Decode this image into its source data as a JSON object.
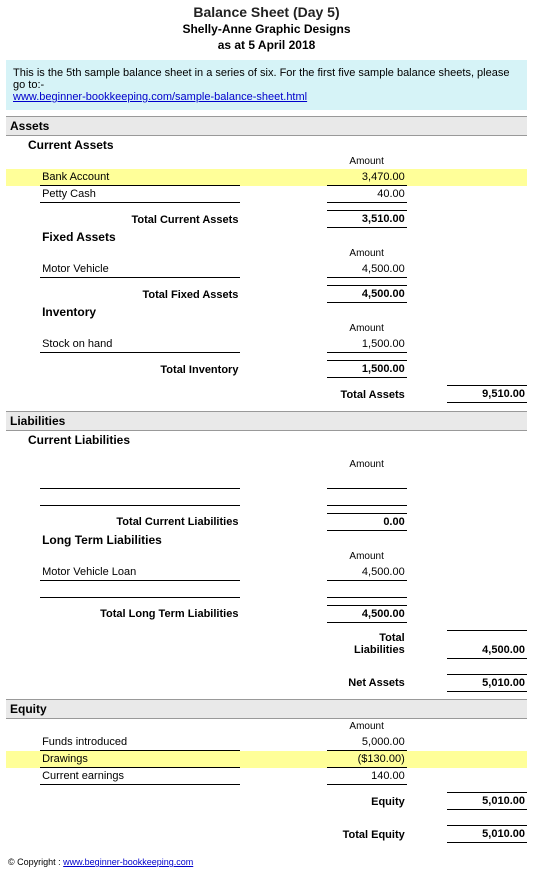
{
  "header": {
    "title": "Balance Sheet (Day 5)",
    "subtitle": "Shelly-Anne Graphic Designs",
    "date": "as at 5 April 2018"
  },
  "note": {
    "text": "This is the 5th sample balance sheet in a series of six. For the first five sample balance sheets, please go to:-",
    "link": "www.beginner-bookkeeping.com/sample-balance-sheet.html"
  },
  "col_amount": "Amount",
  "assets": {
    "heading": "Assets",
    "current": {
      "heading": "Current Assets",
      "items": [
        {
          "label": "Bank Account",
          "value": "3,470.00"
        },
        {
          "label": "Petty Cash",
          "value": "40.00"
        }
      ],
      "total_label": "Total Current Assets",
      "total_value": "3,510.00"
    },
    "fixed": {
      "heading": "Fixed Assets",
      "items": [
        {
          "label": "Motor Vehicle",
          "value": "4,500.00"
        }
      ],
      "total_label": "Total Fixed Assets",
      "total_value": "4,500.00"
    },
    "inventory": {
      "heading": "Inventory",
      "items": [
        {
          "label": "Stock on hand",
          "value": "1,500.00"
        }
      ],
      "total_label": "Total Inventory",
      "total_value": "1,500.00"
    },
    "grand_label": "Total Assets",
    "grand_value": "9,510.00"
  },
  "liabilities": {
    "heading": "Liabilities",
    "current": {
      "heading": "Current Liabilities",
      "total_label": "Total Current Liabilities",
      "total_value": "0.00"
    },
    "longterm": {
      "heading": "Long Term Liabilities",
      "items": [
        {
          "label": "Motor Vehicle Loan",
          "value": "4,500.00"
        }
      ],
      "total_label": "Total Long Term Liabilities",
      "total_value": "4,500.00"
    },
    "grand_label": "Total Liabilities",
    "grand_value": "4,500.00",
    "net_label": "Net Assets",
    "net_value": "5,010.00"
  },
  "equity": {
    "heading": "Equity",
    "items": [
      {
        "label": "Funds introduced",
        "value": "5,000.00"
      },
      {
        "label": "Drawings",
        "value": "($130.00)"
      },
      {
        "label": "Current earnings",
        "value": "140.00"
      }
    ],
    "sub_label": "Equity",
    "sub_value": "5,010.00",
    "grand_label": "Total Equity",
    "grand_value": "5,010.00"
  },
  "footer": {
    "copy": "© Copyright :",
    "link": "www.beginner-bookkeeping.com"
  }
}
